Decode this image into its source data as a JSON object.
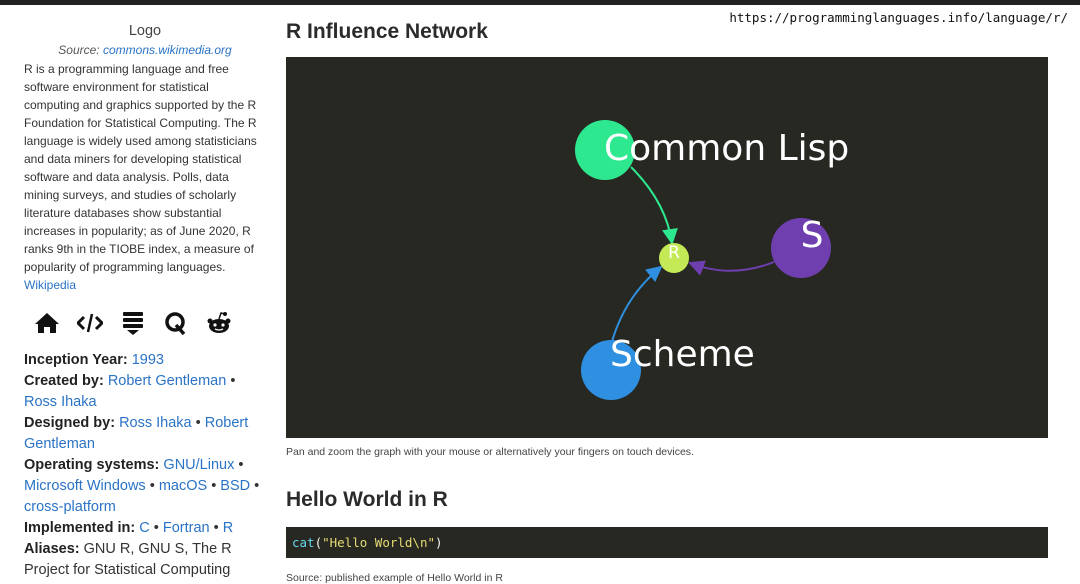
{
  "url": "https://programminglanguages.info/language/r/",
  "sidebar": {
    "logo_label": "Logo",
    "source_prefix": "Source:",
    "source_link": "commons.wikimedia.org",
    "description": "R is a programming language and free software environment for statistical computing and graphics supported by the R Foundation for Statistical Computing. The R language is widely used among statisticians and data miners for developing statistical software and data analysis. Polls, data mining surveys, and studies of scholarly literature databases show substantial increases in popularity; as of June 2020, R ranks 9th in the TIOBE index, a measure of popularity of programming languages.",
    "wikipedia_link": "Wikipedia",
    "icons": [
      "home-icon",
      "code-icon",
      "stack-icon",
      "quora-icon",
      "reddit-icon"
    ],
    "facts": {
      "inception_label": "Inception Year:",
      "inception_value": "1993",
      "created_label": "Created by:",
      "created_1": "Robert Gentleman",
      "created_2": "Ross Ihaka",
      "designed_label": "Designed by:",
      "designed_1": "Ross Ihaka",
      "designed_2": "Robert Gentleman",
      "os_label": "Operating systems:",
      "os_1": "GNU/Linux",
      "os_2": "Microsoft Windows",
      "os_3": "macOS",
      "os_4": "BSD",
      "os_5": "cross-platform",
      "impl_label": "Implemented in:",
      "impl_1": "C",
      "impl_2": "Fortran",
      "impl_3": "R",
      "aliases_label": "Aliases:",
      "aliases_value": "GNU R, GNU S, The R Project for Statistical Computing"
    },
    "separator": "•"
  },
  "main": {
    "title": "R Influence Network",
    "graph": {
      "background": "#272822",
      "nodes": [
        {
          "id": "common-lisp",
          "label": "Common Lisp",
          "color": "#2ee88f"
        },
        {
          "id": "r",
          "label": "R",
          "color": "#c3e956"
        },
        {
          "id": "s",
          "label": "S",
          "color": "#6f3fb0"
        },
        {
          "id": "scheme",
          "label": "Scheme",
          "color": "#2f8fe0"
        }
      ],
      "edges": [
        {
          "from": "common-lisp",
          "to": "r",
          "color": "#2ee88f"
        },
        {
          "from": "s",
          "to": "r",
          "color": "#6f3fb0"
        },
        {
          "from": "scheme",
          "to": "r",
          "color": "#2f8fe0"
        }
      ]
    },
    "caption": "Pan and zoom the graph with your mouse or alternatively your fingers on touch devices.",
    "hello_title": "Hello World in R",
    "code_fn": "cat",
    "code_open": "(",
    "code_str": "\"Hello World\\n\"",
    "code_close": ")",
    "after_text": "Source: published example of Hello World in R"
  }
}
